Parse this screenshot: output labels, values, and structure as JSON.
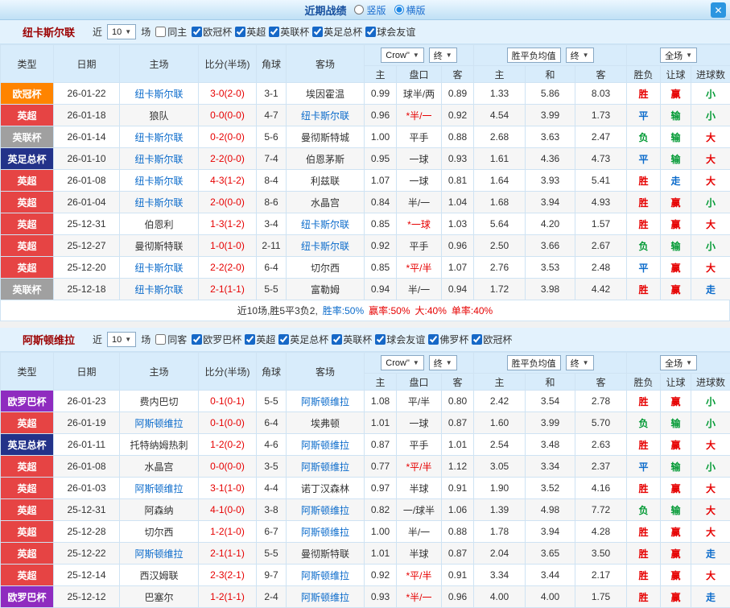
{
  "titlebar": {
    "title": "近期战绩",
    "radios": [
      {
        "label": "竖版",
        "selected": false
      },
      {
        "label": "横版",
        "selected": true
      }
    ],
    "close_label": "✕"
  },
  "table_headers": {
    "type": "类型",
    "date": "日期",
    "home": "主场",
    "score": "比分(半场)",
    "corner": "角球",
    "away": "客场",
    "odds_home": "主",
    "odds_handicap": "盘口",
    "odds_away": "客",
    "avg_home": "主",
    "avg_draw": "和",
    "avg_away": "客",
    "result": "胜负",
    "handicap_result": "让球",
    "goals": "进球数"
  },
  "value_colors": {
    "胜": "#e60000",
    "平": "#0b6bcb",
    "负": "#009933",
    "赢": "#e60000",
    "输": "#009933",
    "走": "#0b6bcb",
    "大": "#e60000",
    "小": "#009933"
  },
  "type_colors": {
    "欧冠杯": "#ff8400",
    "英超": "#e64444",
    "英联杯": "#a0a0a0",
    "英足总杯": "#233289",
    "欧罗巴杯": "#8f2bbf"
  },
  "sections": [
    {
      "team": "纽卡斯尔联",
      "near_label": "近",
      "games": "10",
      "games_suffix": "场",
      "same_label": "同主",
      "leagues": [
        "欧冠杯",
        "英超",
        "英联杯",
        "英足总杯",
        "球会友谊"
      ],
      "selects": {
        "odds": "Crow\"",
        "final_a": "终",
        "avg": "胜平负均值",
        "final_b": "终",
        "scope": "全场"
      },
      "rows": [
        {
          "type": "欧冠杯",
          "date": "26-01-22",
          "home": "纽卡斯尔联",
          "home_focus": true,
          "score": "3-0(2-0)",
          "corner": "3-1",
          "away": "埃因霍温",
          "away_focus": false,
          "odds": [
            "0.99",
            "球半/两",
            "0.89"
          ],
          "avg": [
            "1.33",
            "5.86",
            "8.03"
          ],
          "result": "胜",
          "let": "赢",
          "goals": "小"
        },
        {
          "type": "英超",
          "date": "26-01-18",
          "home": "狼队",
          "home_focus": false,
          "score": "0-0(0-0)",
          "corner": "4-7",
          "away": "纽卡斯尔联",
          "away_focus": true,
          "odds": [
            "0.96",
            "*半/一",
            "0.92"
          ],
          "avg": [
            "4.54",
            "3.99",
            "1.73"
          ],
          "result": "平",
          "let": "输",
          "goals": "小"
        },
        {
          "type": "英联杯",
          "date": "26-01-14",
          "home": "纽卡斯尔联",
          "home_focus": true,
          "score": "0-2(0-0)",
          "corner": "5-6",
          "away": "曼彻斯特城",
          "away_focus": false,
          "odds": [
            "1.00",
            "平手",
            "0.88"
          ],
          "avg": [
            "2.68",
            "3.63",
            "2.47"
          ],
          "result": "负",
          "let": "输",
          "goals": "大"
        },
        {
          "type": "英足总杯",
          "date": "26-01-10",
          "home": "纽卡斯尔联",
          "home_focus": true,
          "score": "2-2(0-0)",
          "corner": "7-4",
          "away": "伯恩茅斯",
          "away_focus": false,
          "odds": [
            "0.95",
            "一球",
            "0.93"
          ],
          "avg": [
            "1.61",
            "4.36",
            "4.73"
          ],
          "result": "平",
          "let": "输",
          "goals": "大"
        },
        {
          "type": "英超",
          "date": "26-01-08",
          "home": "纽卡斯尔联",
          "home_focus": true,
          "score": "4-3(1-2)",
          "corner": "8-4",
          "away": "利兹联",
          "away_focus": false,
          "odds": [
            "1.07",
            "一球",
            "0.81"
          ],
          "avg": [
            "1.64",
            "3.93",
            "5.41"
          ],
          "result": "胜",
          "let": "走",
          "goals": "大"
        },
        {
          "type": "英超",
          "date": "26-01-04",
          "home": "纽卡斯尔联",
          "home_focus": true,
          "score": "2-0(0-0)",
          "corner": "8-6",
          "away": "水晶宫",
          "away_focus": false,
          "odds": [
            "0.84",
            "半/一",
            "1.04"
          ],
          "avg": [
            "1.68",
            "3.94",
            "4.93"
          ],
          "result": "胜",
          "let": "赢",
          "goals": "小"
        },
        {
          "type": "英超",
          "date": "25-12-31",
          "home": "伯恩利",
          "home_focus": false,
          "score": "1-3(1-2)",
          "corner": "3-4",
          "away": "纽卡斯尔联",
          "away_focus": true,
          "odds": [
            "0.85",
            "*一球",
            "1.03"
          ],
          "avg": [
            "5.64",
            "4.20",
            "1.57"
          ],
          "result": "胜",
          "let": "赢",
          "goals": "大"
        },
        {
          "type": "英超",
          "date": "25-12-27",
          "home": "曼彻斯特联",
          "home_focus": false,
          "score": "1-0(1-0)",
          "corner": "2-11",
          "away": "纽卡斯尔联",
          "away_focus": true,
          "odds": [
            "0.92",
            "平手",
            "0.96"
          ],
          "avg": [
            "2.50",
            "3.66",
            "2.67"
          ],
          "result": "负",
          "let": "输",
          "goals": "小"
        },
        {
          "type": "英超",
          "date": "25-12-20",
          "home": "纽卡斯尔联",
          "home_focus": true,
          "score": "2-2(2-0)",
          "corner": "6-4",
          "away": "切尔西",
          "away_focus": false,
          "odds": [
            "0.85",
            "*平/半",
            "1.07"
          ],
          "avg": [
            "2.76",
            "3.53",
            "2.48"
          ],
          "result": "平",
          "let": "赢",
          "goals": "大"
        },
        {
          "type": "英联杯",
          "date": "25-12-18",
          "home": "纽卡斯尔联",
          "home_focus": true,
          "score": "2-1(1-1)",
          "corner": "5-5",
          "away": "富勒姆",
          "away_focus": false,
          "odds": [
            "0.94",
            "半/一",
            "0.94"
          ],
          "avg": [
            "1.72",
            "3.98",
            "4.42"
          ],
          "result": "胜",
          "let": "赢",
          "goals": "走"
        }
      ],
      "summary": [
        {
          "text": "近10场,胜5平3负2,",
          "color": "#333333"
        },
        {
          "text": "胜率:50%",
          "color": "#0b6bcb"
        },
        {
          "text": "赢率:50%",
          "color": "#e60000"
        },
        {
          "text": "大:40%",
          "color": "#e60000"
        },
        {
          "text": "单率:40%",
          "color": "#e60000"
        }
      ]
    },
    {
      "team": "阿斯顿维拉",
      "near_label": "近",
      "games": "10",
      "games_suffix": "场",
      "same_label": "同客",
      "leagues": [
        "欧罗巴杯",
        "英超",
        "英足总杯",
        "英联杯",
        "球会友谊",
        "佛罗杯",
        "欧冠杯"
      ],
      "selects": {
        "odds": "Crow\"",
        "final_a": "终",
        "avg": "胜平负均值",
        "final_b": "终",
        "scope": "全场"
      },
      "rows": [
        {
          "type": "欧罗巴杯",
          "date": "26-01-23",
          "home": "费内巴切",
          "home_focus": false,
          "score": "0-1(0-1)",
          "corner": "5-5",
          "away": "阿斯顿维拉",
          "away_focus": true,
          "odds": [
            "1.08",
            "平/半",
            "0.80"
          ],
          "avg": [
            "2.42",
            "3.54",
            "2.78"
          ],
          "result": "胜",
          "let": "赢",
          "goals": "小"
        },
        {
          "type": "英超",
          "date": "26-01-19",
          "home": "阿斯顿维拉",
          "home_focus": true,
          "score": "0-1(0-0)",
          "corner": "6-4",
          "away": "埃弗顿",
          "away_focus": false,
          "odds": [
            "1.01",
            "一球",
            "0.87"
          ],
          "avg": [
            "1.60",
            "3.99",
            "5.70"
          ],
          "result": "负",
          "let": "输",
          "goals": "小"
        },
        {
          "type": "英足总杯",
          "date": "26-01-11",
          "home": "托特纳姆热刺",
          "home_focus": false,
          "score": "1-2(0-2)",
          "corner": "4-6",
          "away": "阿斯顿维拉",
          "away_focus": true,
          "odds": [
            "0.87",
            "平手",
            "1.01"
          ],
          "avg": [
            "2.54",
            "3.48",
            "2.63"
          ],
          "result": "胜",
          "let": "赢",
          "goals": "大"
        },
        {
          "type": "英超",
          "date": "26-01-08",
          "home": "水晶宫",
          "home_focus": false,
          "score": "0-0(0-0)",
          "corner": "3-5",
          "away": "阿斯顿维拉",
          "away_focus": true,
          "odds": [
            "0.77",
            "*平/半",
            "1.12"
          ],
          "avg": [
            "3.05",
            "3.34",
            "2.37"
          ],
          "result": "平",
          "let": "输",
          "goals": "小"
        },
        {
          "type": "英超",
          "date": "26-01-03",
          "home": "阿斯顿维拉",
          "home_focus": true,
          "score": "3-1(1-0)",
          "corner": "4-4",
          "away": "诺丁汉森林",
          "away_focus": false,
          "odds": [
            "0.97",
            "半球",
            "0.91"
          ],
          "avg": [
            "1.90",
            "3.52",
            "4.16"
          ],
          "result": "胜",
          "let": "赢",
          "goals": "大"
        },
        {
          "type": "英超",
          "date": "25-12-31",
          "home": "阿森纳",
          "home_focus": false,
          "score": "4-1(0-0)",
          "corner": "3-8",
          "away": "阿斯顿维拉",
          "away_focus": true,
          "odds": [
            "0.82",
            "一/球半",
            "1.06"
          ],
          "avg": [
            "1.39",
            "4.98",
            "7.72"
          ],
          "result": "负",
          "let": "输",
          "goals": "大"
        },
        {
          "type": "英超",
          "date": "25-12-28",
          "home": "切尔西",
          "home_focus": false,
          "score": "1-2(1-0)",
          "corner": "6-7",
          "away": "阿斯顿维拉",
          "away_focus": true,
          "odds": [
            "1.00",
            "半/一",
            "0.88"
          ],
          "avg": [
            "1.78",
            "3.94",
            "4.28"
          ],
          "result": "胜",
          "let": "赢",
          "goals": "大"
        },
        {
          "type": "英超",
          "date": "25-12-22",
          "home": "阿斯顿维拉",
          "home_focus": true,
          "score": "2-1(1-1)",
          "corner": "5-5",
          "away": "曼彻斯特联",
          "away_focus": false,
          "odds": [
            "1.01",
            "半球",
            "0.87"
          ],
          "avg": [
            "2.04",
            "3.65",
            "3.50"
          ],
          "result": "胜",
          "let": "赢",
          "goals": "走"
        },
        {
          "type": "英超",
          "date": "25-12-14",
          "home": "西汉姆联",
          "home_focus": false,
          "score": "2-3(2-1)",
          "corner": "9-7",
          "away": "阿斯顿维拉",
          "away_focus": true,
          "odds": [
            "0.92",
            "*平/半",
            "0.91"
          ],
          "avg": [
            "3.34",
            "3.44",
            "2.17"
          ],
          "result": "胜",
          "let": "赢",
          "goals": "大"
        },
        {
          "type": "欧罗巴杯",
          "date": "25-12-12",
          "home": "巴塞尔",
          "home_focus": false,
          "score": "1-2(1-1)",
          "corner": "2-4",
          "away": "阿斯顿维拉",
          "away_focus": true,
          "odds": [
            "0.93",
            "*半/一",
            "0.96"
          ],
          "avg": [
            "4.00",
            "4.00",
            "1.75"
          ],
          "result": "胜",
          "let": "赢",
          "goals": "走"
        }
      ],
      "summary": null
    }
  ]
}
